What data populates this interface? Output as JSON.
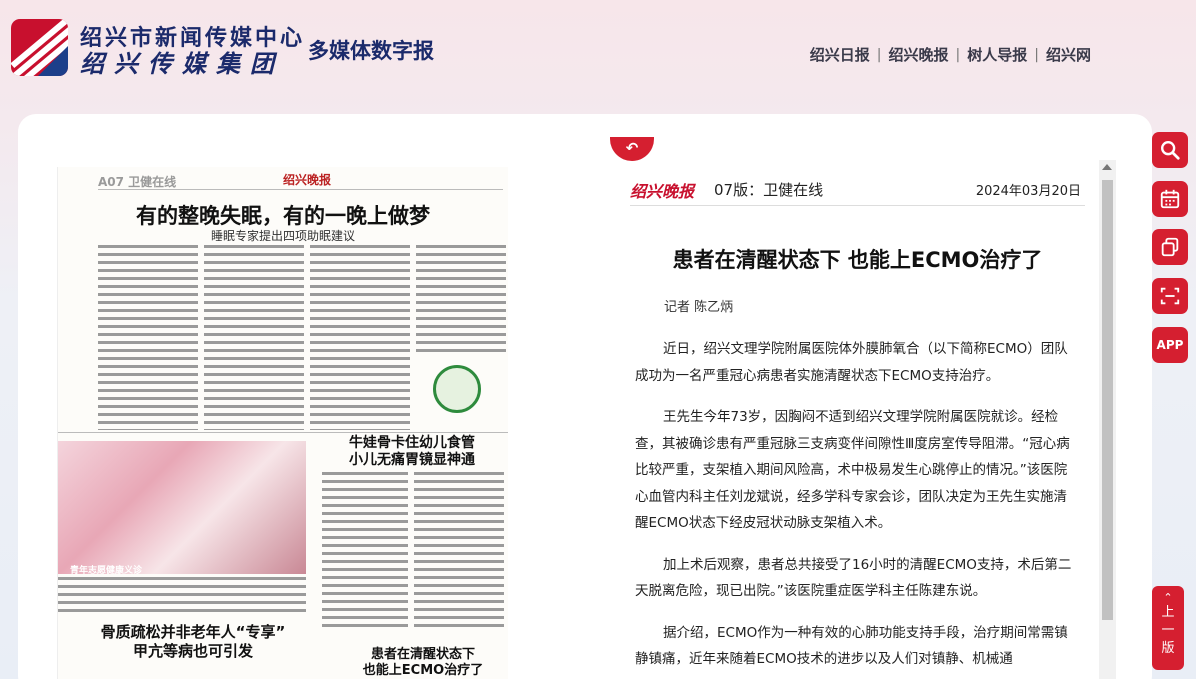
{
  "header": {
    "org_name": "绍兴市新闻传媒中心",
    "org_group": "绍兴传媒集团",
    "site_title": "多媒体数字报",
    "nav": [
      "绍兴日报",
      "绍兴晚报",
      "树人导报",
      "绍兴网"
    ]
  },
  "paper_thumb": {
    "edition": "A07 卫健在线",
    "masthead": "绍兴晚报",
    "headline1": "有的整晚失眠，有的一晚上做梦",
    "sub1": "睡眠专家提出四项助眠建议",
    "headline2": "牛娃骨卡住幼儿食管\n小儿无痛胃镜显神通",
    "headline3": "骨质疏松并非老年人“专享”\n甲亢等病也可引发",
    "headline4": "患者在清醒状态下\n也能上ECMO治疗了",
    "photo_caption": "青年志愿健康义诊"
  },
  "article": {
    "brand": "绍兴晚报",
    "edition": "07版：卫健在线",
    "date": "2024年03月20日",
    "title": "患者在清醒状态下 也能上ECMO治疗了",
    "author": "记者 陈乙炳",
    "paragraphs": [
      "近日，绍兴文理学院附属医院体外膜肺氧合（以下简称ECMO）团队成功为一名严重冠心病患者实施清醒状态下ECMO支持治疗。",
      "王先生今年73岁，因胸闷不适到绍兴文理学院附属医院就诊。经检查，其被确诊患有严重冠脉三支病变伴间隙性Ⅲ度房室传导阻滞。“冠心病比较严重，支架植入期间风险高，术中极易发生心跳停止的情况。”该医院心血管内科主任刘龙斌说，经多学科专家会诊，团队决定为王先生实施清醒ECMO状态下经皮冠状动脉支架植入术。",
      "加上术后观察，患者总共接受了16小时的清醒ECMO支持，术后第二天脱离危险，现已出院。”该医院重症医学科主任陈建东说。",
      "据介绍，ECMO作为一种有效的心肺功能支持手段，治疗期间常需镇静镇痛，近年来随着ECMO技术的进步以及人们对镇静、机械通"
    ]
  },
  "toolbar": {
    "app_label": "APP",
    "prev_page": "上\n一\n版",
    "prev_arrow": "⌃"
  },
  "colors": {
    "accent": "#d51f30",
    "brand_blue": "#1b2a6b"
  }
}
